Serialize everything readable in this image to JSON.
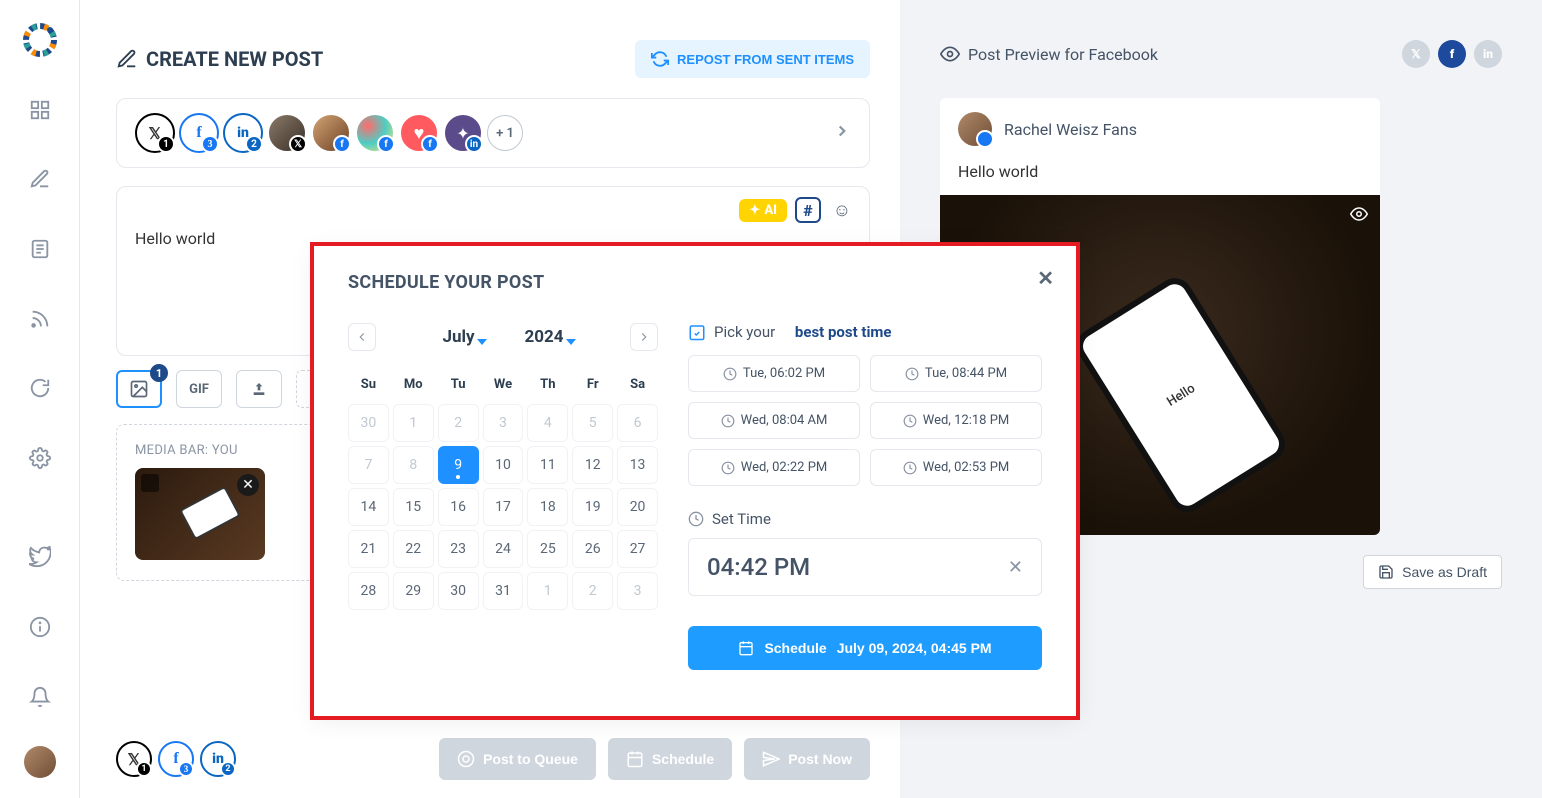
{
  "header": {
    "title": "CREATE NEW POST",
    "repost": "REPOST FROM SENT ITEMS"
  },
  "accounts": {
    "x_badge": "1",
    "fb_badge": "3",
    "li_badge": "2",
    "plus": "+ 1"
  },
  "editor": {
    "text": "Hello world",
    "ai": "AI",
    "hash": "#"
  },
  "mediaRow": {
    "img_badge": "1",
    "gif": "GIF"
  },
  "mediaBar": {
    "label": "MEDIA BAR: YOU"
  },
  "footer": {
    "x_badge": "1",
    "fb_badge": "3",
    "li_badge": "2",
    "queue": "Post to Queue",
    "schedule": "Schedule",
    "now": "Post Now"
  },
  "preview": {
    "head": "Post Preview for Facebook",
    "name": "Rachel Weisz Fans",
    "text": "Hello world",
    "phone_text": "Hello",
    "save": "Save as Draft"
  },
  "modal": {
    "title": "SCHEDULE YOUR POST",
    "month": "July",
    "year": "2024",
    "dow": [
      "Su",
      "Mo",
      "Tu",
      "We",
      "Th",
      "Fr",
      "Sa"
    ],
    "days": [
      {
        "n": "30",
        "m": true
      },
      {
        "n": "1",
        "m": true
      },
      {
        "n": "2",
        "m": true
      },
      {
        "n": "3",
        "m": true
      },
      {
        "n": "4",
        "m": true
      },
      {
        "n": "5",
        "m": true
      },
      {
        "n": "6",
        "m": true
      },
      {
        "n": "7",
        "m": true
      },
      {
        "n": "8",
        "m": true
      },
      {
        "n": "9",
        "sel": true
      },
      {
        "n": "10"
      },
      {
        "n": "11"
      },
      {
        "n": "12"
      },
      {
        "n": "13"
      },
      {
        "n": "14"
      },
      {
        "n": "15"
      },
      {
        "n": "16"
      },
      {
        "n": "17"
      },
      {
        "n": "18"
      },
      {
        "n": "19"
      },
      {
        "n": "20"
      },
      {
        "n": "21"
      },
      {
        "n": "22"
      },
      {
        "n": "23"
      },
      {
        "n": "24"
      },
      {
        "n": "25"
      },
      {
        "n": "26"
      },
      {
        "n": "27"
      },
      {
        "n": "28"
      },
      {
        "n": "29"
      },
      {
        "n": "30"
      },
      {
        "n": "31"
      },
      {
        "n": "1",
        "m": true
      },
      {
        "n": "2",
        "m": true
      },
      {
        "n": "3",
        "m": true
      }
    ],
    "pick_prefix": "Pick your",
    "pick_bold": "best post time",
    "times": [
      "Tue, 06:02 PM",
      "Tue, 08:44 PM",
      "Wed, 08:04 AM",
      "Wed, 12:18 PM",
      "Wed, 02:22 PM",
      "Wed, 02:53 PM"
    ],
    "settime": "Set Time",
    "time_value": "04:42 PM",
    "schedule_label": "Schedule",
    "schedule_dt": "July 09, 2024, 04:45 PM"
  }
}
